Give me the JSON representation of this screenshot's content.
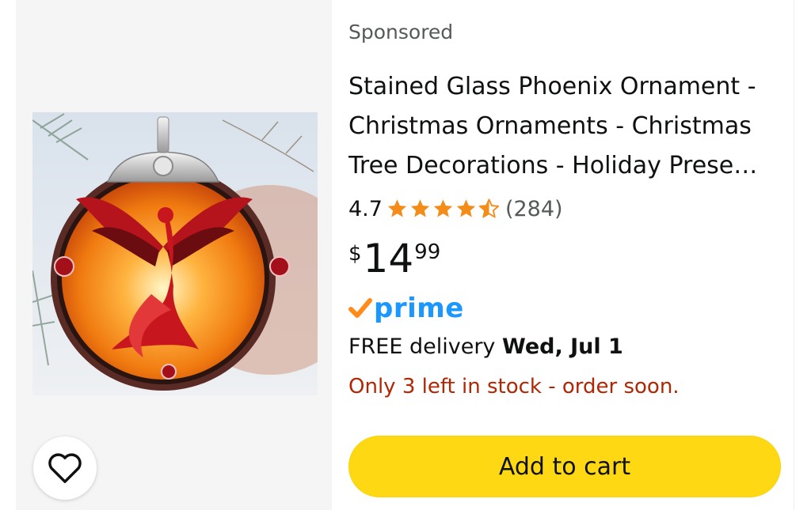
{
  "product": {
    "sponsored_label": "Sponsored",
    "title": "Stained Glass Phoenix Ornament - Christmas Ornaments - Christmas Tree Decorations - Holiday Prese…",
    "rating": {
      "value": "4.7",
      "stars_filled": 4.5,
      "review_count": "(284)",
      "star_color": "#f48c1a"
    },
    "price": {
      "symbol": "$",
      "whole": "14",
      "fraction": "99"
    },
    "prime": {
      "label": "prime",
      "check_color": "#ff8c1a",
      "text_color": "#1a98ff"
    },
    "delivery": {
      "prefix": "FREE delivery",
      "date": "Wed, Jul 1"
    },
    "stock_message": "Only 3 left in stock - order soon.",
    "add_to_cart_label": "Add to cart",
    "image_name": "phoenix-ornament-image",
    "wishlist_icon": "heart-icon"
  },
  "colors": {
    "button_yellow": "#ffd814",
    "stock_red": "#b12704",
    "panel_gray": "#f5f5f5"
  }
}
